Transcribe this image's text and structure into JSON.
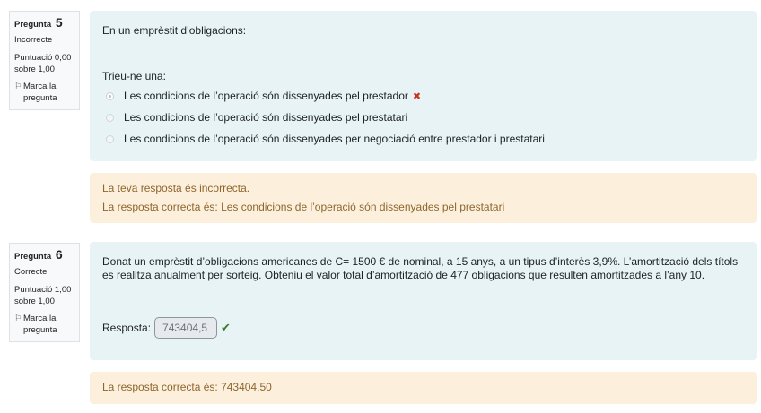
{
  "q5": {
    "label": "Pregunta",
    "number": "5",
    "state": "Incorrecte",
    "grade": "Puntuació 0,00 sobre 1,00",
    "flag": "Marca la pregunta",
    "text": "En un emprèstit d’obligacions:",
    "prompt": "Trieu-ne una:",
    "options": [
      "Les condicions de l’operació són dissenyades pel prestador",
      "Les condicions de l’operació són dissenyades pel prestatari",
      "Les condicions de l’operació són dissenyades per negociació entre prestador i prestatari"
    ],
    "feedback": "La teva resposta és incorrecta.",
    "right_answer": "La resposta correcta és: Les condicions de l’operació són dissenyades pel prestatari"
  },
  "q6": {
    "label": "Pregunta",
    "number": "6",
    "state": "Correcte",
    "grade": "Puntuació 1,00 sobre 1,00",
    "flag": "Marca la pregunta",
    "text": "Donat un emprèstit d’obligacions americanes de C= 1500  € de nominal, a  15 anys, a un tipus d’interès 3,9%. L’amortització dels títols es realitza anualment per sorteig. Obteniu el valor total d’amortització de 477 obligacions que resulten amortitzades a l’any 10.",
    "answer_label": "Resposta:",
    "answer_value": "743404,5",
    "right_answer": "La resposta correcta és: 743404,50"
  },
  "icons": {
    "flag": "flag-icon",
    "incorrect": "cross-icon",
    "correct": "check-icon"
  },
  "colors": {
    "formulation_bg": "#e7f3f5",
    "outcome_bg": "#fcefdc",
    "outcome_text": "#8e662e",
    "incorrect": "#ca3120",
    "correct": "#357a32"
  }
}
